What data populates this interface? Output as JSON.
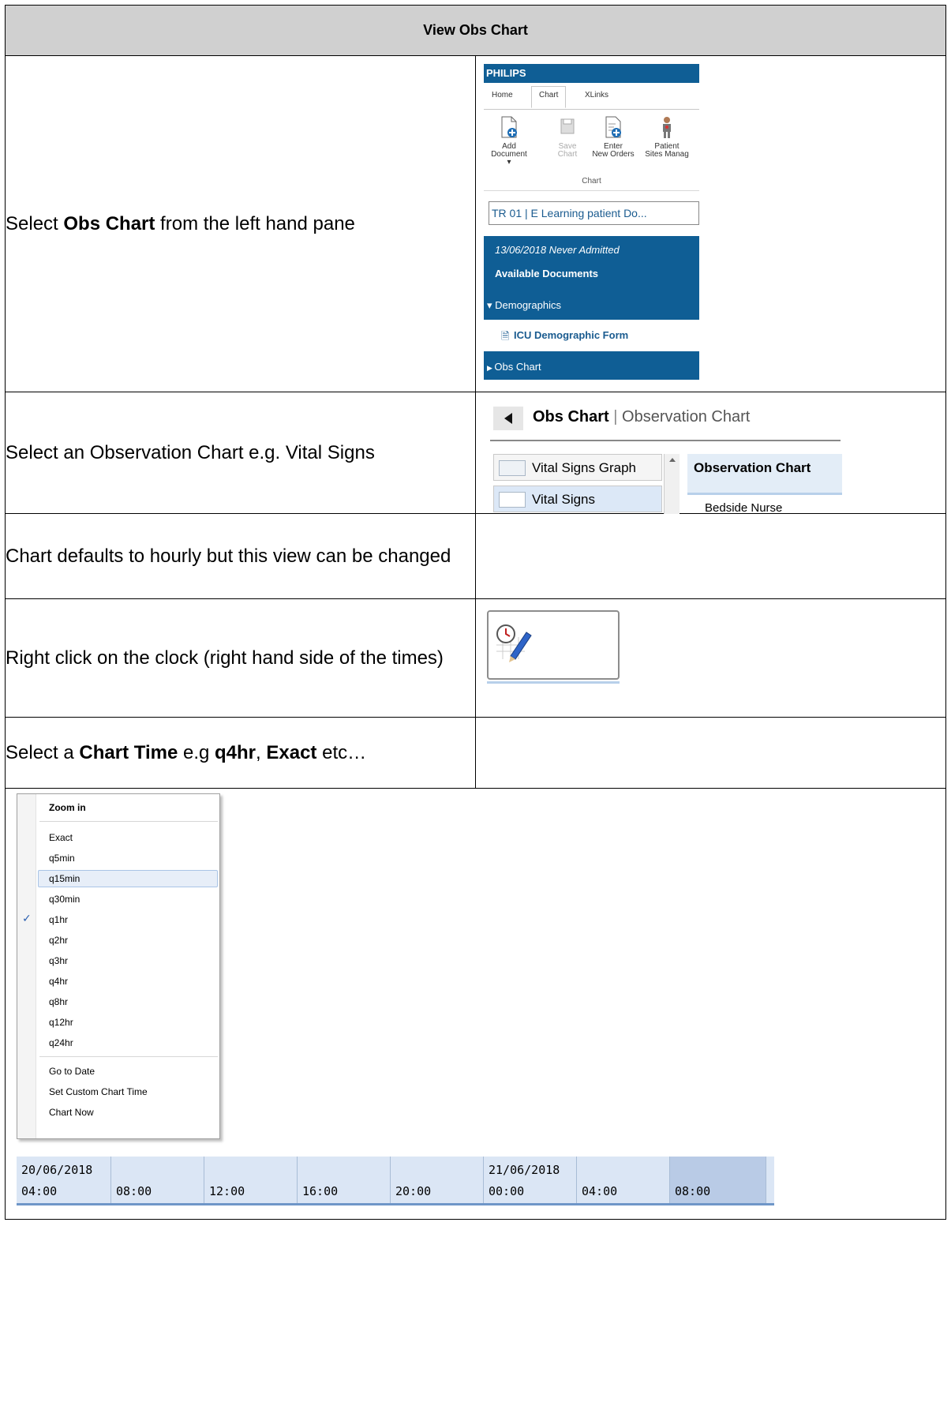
{
  "header": {
    "title": "View Obs Chart"
  },
  "rows": [
    {
      "instruction_parts": [
        "Select ",
        "Obs Chart",
        " from the left hand pane"
      ]
    },
    {
      "instruction": "Select an Observation Chart e.g. Vital Signs"
    },
    {
      "instruction": "Chart defaults to hourly but this view can be changed"
    },
    {
      "instruction": "Right click on the clock (right hand side of the times)"
    },
    {
      "instruction_parts": [
        "Select a ",
        "Chart Time",
        " e.g ",
        "q4hr",
        ", ",
        "Exact",
        " etc…"
      ]
    }
  ],
  "philips": {
    "brand": "PHILIPS",
    "tabs": [
      "Home",
      "Chart",
      "XLinks"
    ],
    "active_tab": "Chart",
    "ribbon": {
      "buttons": [
        {
          "line1": "Add",
          "line2": "Document ▾"
        },
        {
          "line1": "Save",
          "line2": "Chart"
        },
        {
          "line1": "Enter",
          "line2": "New Orders"
        },
        {
          "line1": "Patient",
          "line2": "Sites Manag"
        }
      ],
      "group_label": "Chart"
    },
    "patient_bar": "TR 01   | E Learning patient Do...",
    "admission": "13/06/2018 Never Admitted",
    "available_docs": "Available Documents",
    "demographics": "Demographics",
    "icu_form": "ICU Demographic Form",
    "obs_chart": "Obs Chart"
  },
  "obs_chart_view": {
    "title_bold": "Obs Chart",
    "separator": "|",
    "title_rest": "Observation Chart",
    "list_items": [
      "Vital Signs Graph",
      "Vital Signs"
    ],
    "panel_title": "Observation Chart",
    "bedside": "Bedside Nurse"
  },
  "context_menu": {
    "header": "Zoom in",
    "items": [
      "Exact",
      "q5min",
      "q15min",
      "q30min",
      "q1hr",
      "q2hr",
      "q3hr",
      "q4hr",
      "q8hr",
      "q12hr",
      "q24hr"
    ],
    "highlighted": "q15min",
    "checked": "q1hr",
    "footer_items": [
      "Go to Date",
      "Set Custom Chart Time",
      "Chart Now"
    ]
  },
  "timeline": [
    {
      "date": "20/06/2018",
      "time": "04:00"
    },
    {
      "date": "",
      "time": "08:00"
    },
    {
      "date": "",
      "time": "12:00"
    },
    {
      "date": "",
      "time": "16:00"
    },
    {
      "date": "",
      "time": "20:00"
    },
    {
      "date": "21/06/2018",
      "time": "00:00"
    },
    {
      "date": "",
      "time": "04:00"
    },
    {
      "date": "",
      "time": "08:00",
      "selected": true
    }
  ]
}
